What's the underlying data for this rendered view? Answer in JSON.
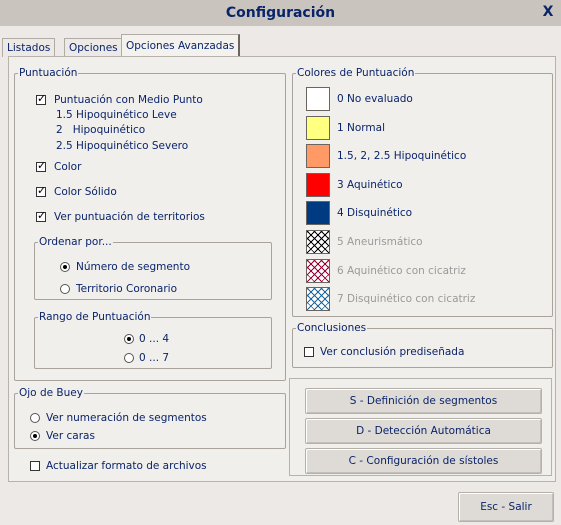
{
  "window": {
    "title": "Configuración",
    "close_symbol": "X"
  },
  "tabs": [
    {
      "label": "Listados",
      "active": false
    },
    {
      "label": "Opciones",
      "active": false
    },
    {
      "label": "Opciones Avanzadas",
      "active": true
    }
  ],
  "puntuacion": {
    "legend": "Puntuación",
    "medio_punto": {
      "label": "Puntuación con Medio Punto",
      "checked": true
    },
    "sub_lines": [
      "1.5 Hipoquinético Leve",
      "2   Hipoquinético",
      "2.5 Hipoquinético Severo"
    ],
    "color": {
      "label": "Color",
      "checked": true
    },
    "color_solido": {
      "label": "Color Sólido",
      "checked": true
    },
    "territorios": {
      "label": "Ver puntuación de territorios",
      "checked": true
    },
    "ordenar": {
      "legend": "Ordenar por...",
      "options": [
        {
          "label": "Número de segmento",
          "selected": true
        },
        {
          "label": "Territorio Coronario",
          "selected": false
        }
      ]
    },
    "rango": {
      "legend": "Rango de Puntuación",
      "options": [
        {
          "label": "0 ... 4",
          "selected": true
        },
        {
          "label": "0 ... 7",
          "selected": false
        }
      ]
    }
  },
  "colores": {
    "legend": "Colores de Puntuación",
    "items": [
      {
        "label": "0 No evaluado",
        "color": "#ffffff",
        "hatch": false,
        "enabled": true
      },
      {
        "label": "1 Normal",
        "color": "#ffff80",
        "hatch": false,
        "enabled": true
      },
      {
        "label": "1.5, 2, 2.5 Hipoquinético",
        "color": "#ff9966",
        "hatch": false,
        "enabled": true
      },
      {
        "label": "3 Aquinético",
        "color": "#ff0000",
        "hatch": false,
        "enabled": true
      },
      {
        "label": "4 Disquinético",
        "color": "#003a80",
        "hatch": false,
        "enabled": true
      },
      {
        "label": "5 Aneurismático",
        "color": "#000000",
        "hatch": true,
        "enabled": false
      },
      {
        "label": "6 Aquinético con cicatriz",
        "color": "#990033",
        "hatch": true,
        "enabled": false
      },
      {
        "label": "7 Disquinético con cicatriz",
        "color": "#1f6699",
        "hatch": true,
        "enabled": false
      }
    ]
  },
  "conclusiones": {
    "legend": "Conclusiones",
    "ver": {
      "label": "Ver conclusión prediseñada",
      "checked": false
    }
  },
  "ojo": {
    "legend": "Ojo de Buey",
    "options": [
      {
        "label": "Ver numeración de segmentos",
        "selected": false
      },
      {
        "label": "Ver caras",
        "selected": true
      }
    ]
  },
  "actualizar": {
    "label": "Actualizar formato de archivos",
    "checked": false
  },
  "buttons": {
    "segmentos": "S - Definición de segmentos",
    "deteccion": "D - Detección Automática",
    "sistoles": "C - Configuración de sístoles",
    "salir": "Esc - Salir"
  }
}
